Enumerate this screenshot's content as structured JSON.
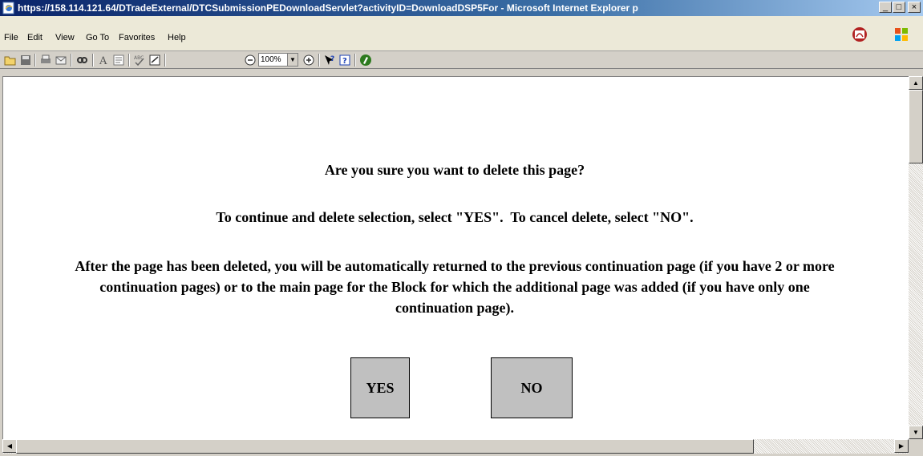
{
  "window": {
    "title": "https://158.114.121.64/DTradeExternal/DTCSubmissionPEDownloadServlet?activityID=DownloadDSP5For - Microsoft Internet Explorer p",
    "minimize_label": "_",
    "maximize_label": "□",
    "close_label": "×"
  },
  "menu": {
    "items": [
      "File",
      "Edit",
      "View",
      "Go To",
      "Favorites",
      "Help"
    ]
  },
  "toolbar": {
    "zoom_value": "100%",
    "icons": [
      "open-folder-icon",
      "save-icon",
      "print-icon",
      "email-icon",
      "find-icon",
      "text-tool-icon",
      "select-text-icon",
      "spell-check-icon",
      "markup-icon",
      "zoom-out-icon",
      "zoom-in-icon",
      "whats-this-icon",
      "help-icon",
      "adobe-online-icon"
    ]
  },
  "page": {
    "question": "Are you sure you want to delete this page?",
    "instruction": "To continue and delete selection, select \"YES\".  To cancel delete, select \"NO\".",
    "after_delete": "After the page has been deleted, you will be automatically returned to the previous continuation page (if you have 2 or more continuation pages) or to the main page for the Block for which the additional page was added (if you have only one continuation page).",
    "yes_label": "YES",
    "no_label": "NO"
  },
  "colors": {
    "titlebar_start": "#0a246a",
    "titlebar_end": "#a6caf0",
    "button_face": "#c0c0c0",
    "chrome": "#d4d0c8"
  }
}
